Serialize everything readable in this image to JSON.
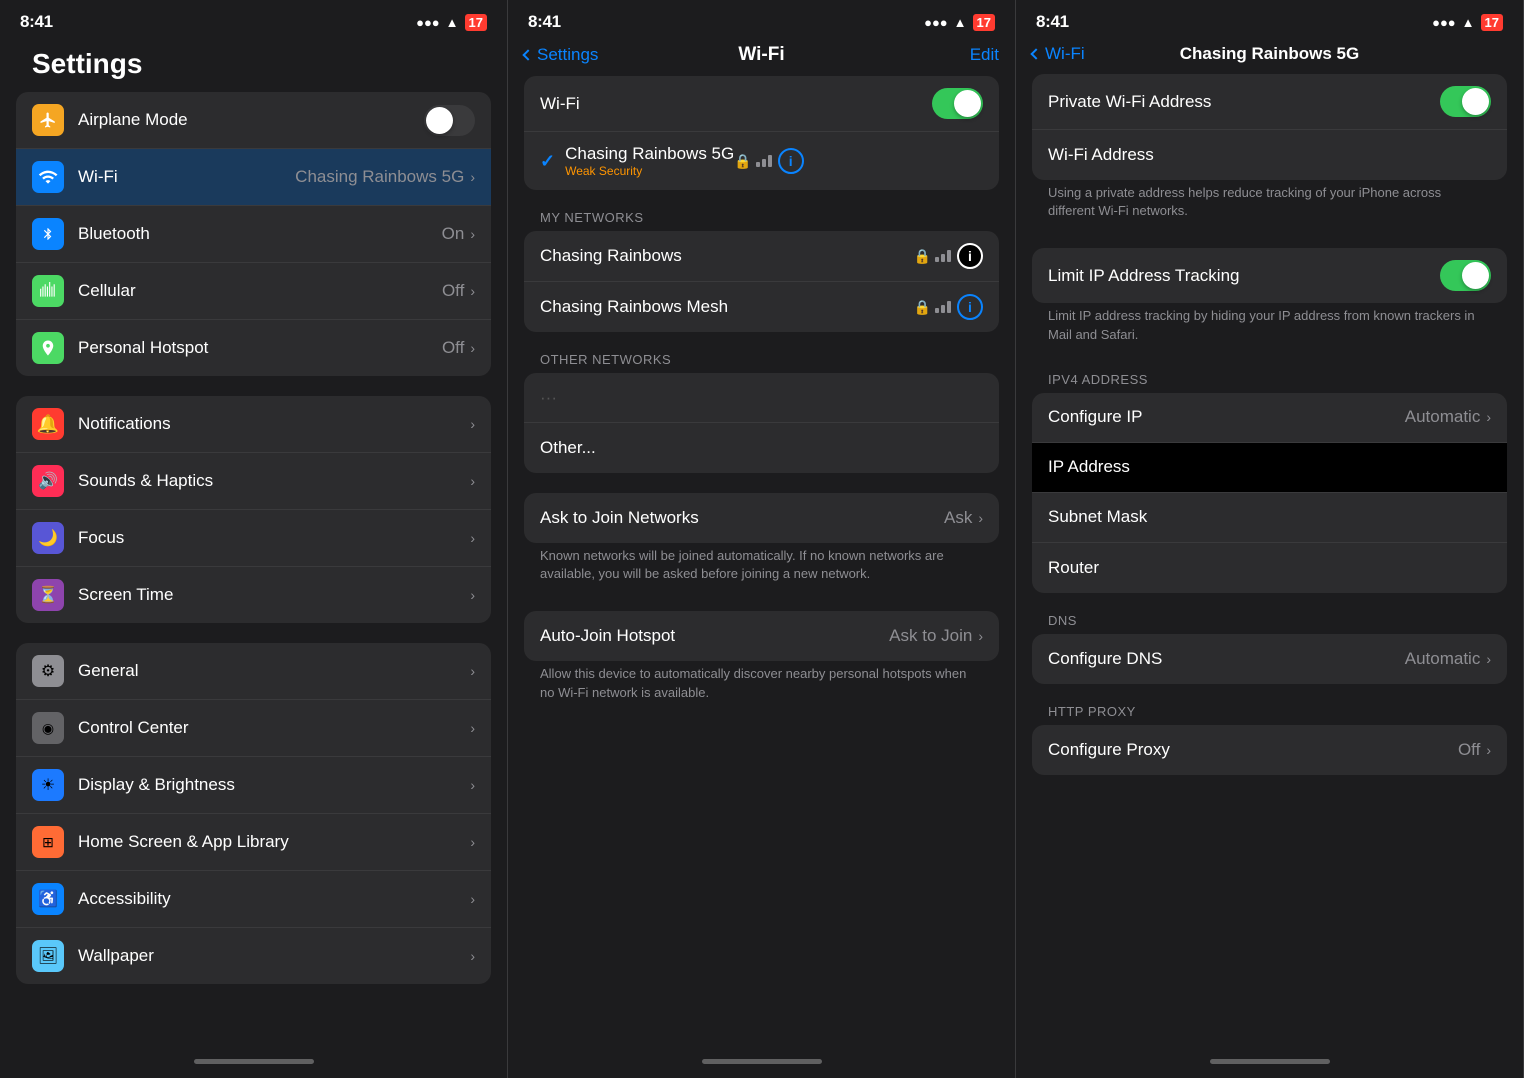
{
  "screens": [
    {
      "id": "settings-main",
      "statusBar": {
        "time": "8:41",
        "userIcon": "👤",
        "batteryValue": "17"
      },
      "title": "Settings",
      "groups": [
        {
          "id": "connectivity",
          "rows": [
            {
              "id": "airplane",
              "icon": "✈",
              "iconBg": "airplane",
              "label": "Airplane Mode",
              "toggle": "off",
              "hasChevron": false
            },
            {
              "id": "wifi",
              "icon": "wifi",
              "iconBg": "wifi",
              "label": "Wi-Fi",
              "value": "Chasing Rainbows 5G",
              "hasChevron": true,
              "highlighted": true
            },
            {
              "id": "bluetooth",
              "icon": "bluetooth",
              "iconBg": "bluetooth",
              "label": "Bluetooth",
              "value": "On",
              "hasChevron": true
            },
            {
              "id": "cellular",
              "icon": "cellular",
              "iconBg": "cellular",
              "label": "Cellular",
              "value": "Off",
              "hasChevron": true
            },
            {
              "id": "hotspot",
              "icon": "hotspot",
              "iconBg": "hotspot",
              "label": "Personal Hotspot",
              "value": "Off",
              "hasChevron": true
            }
          ]
        },
        {
          "id": "system1",
          "rows": [
            {
              "id": "notifications",
              "icon": "🔔",
              "iconBg": "notif",
              "label": "Notifications",
              "hasChevron": true
            },
            {
              "id": "sounds",
              "icon": "🔊",
              "iconBg": "sounds",
              "label": "Sounds & Haptics",
              "hasChevron": true
            },
            {
              "id": "focus",
              "icon": "🌙",
              "iconBg": "focus",
              "label": "Focus",
              "hasChevron": true
            },
            {
              "id": "screentime",
              "icon": "⏳",
              "iconBg": "screentime",
              "label": "Screen Time",
              "hasChevron": true
            }
          ]
        },
        {
          "id": "system2",
          "rows": [
            {
              "id": "general",
              "icon": "⚙",
              "iconBg": "general",
              "label": "General",
              "hasChevron": true
            },
            {
              "id": "controlcenter",
              "icon": "◉",
              "iconBg": "control",
              "label": "Control Center",
              "hasChevron": true
            },
            {
              "id": "display",
              "icon": "☀",
              "iconBg": "display",
              "label": "Display & Brightness",
              "hasChevron": true
            },
            {
              "id": "homescreen",
              "icon": "⊞",
              "iconBg": "homescreen",
              "label": "Home Screen & App Library",
              "hasChevron": true
            },
            {
              "id": "accessibility",
              "icon": "♿",
              "iconBg": "accessibility",
              "label": "Accessibility",
              "hasChevron": true
            },
            {
              "id": "wallpaper",
              "icon": "🖼",
              "iconBg": "wallpaper",
              "label": "Wallpaper",
              "hasChevron": true
            }
          ]
        }
      ]
    },
    {
      "id": "wifi-list",
      "statusBar": {
        "time": "8:41",
        "batteryValue": "17"
      },
      "backLabel": "Settings",
      "title": "Wi-Fi",
      "editLabel": "Edit",
      "groups": [
        {
          "id": "wifi-toggle",
          "rows": [
            {
              "id": "wifi-main",
              "label": "Wi-Fi",
              "toggle": "on"
            },
            {
              "id": "chasing-5g",
              "label": "Chasing Rainbows 5G",
              "sublabel": "Weak Security",
              "hasLock": true,
              "hasWifi": true,
              "hasInfo": true,
              "hasCheck": true
            }
          ]
        },
        {
          "id": "my-networks",
          "sectionLabel": "MY NETWORKS",
          "rows": [
            {
              "id": "chasing-rainbows",
              "label": "Chasing Rainbows",
              "hasLock": true,
              "hasWifi": true,
              "hasInfo": true,
              "infoHighlighted": true
            },
            {
              "id": "chasing-mesh",
              "label": "Chasing Rainbows Mesh",
              "hasLock": true,
              "hasWifi": true,
              "hasInfo": true
            }
          ]
        },
        {
          "id": "other-networks",
          "sectionLabel": "OTHER NETWORKS",
          "rows": [
            {
              "id": "other-dimmed",
              "label": "...",
              "dimmed": true
            },
            {
              "id": "other",
              "label": "Other..."
            }
          ]
        },
        {
          "id": "ask-join",
          "rows": [
            {
              "id": "ask-to-join",
              "label": "Ask to Join Networks",
              "value": "Ask",
              "hasChevron": true,
              "description": "Known networks will be joined automatically. If no known networks are available, you will be asked before joining a new network."
            }
          ]
        },
        {
          "id": "auto-join",
          "rows": [
            {
              "id": "auto-join-hotspot",
              "label": "Auto-Join Hotspot",
              "value": "Ask to Join",
              "hasChevron": true,
              "description": "Allow this device to automatically discover nearby personal hotspots when no Wi-Fi network is available."
            }
          ]
        }
      ]
    },
    {
      "id": "network-detail",
      "statusBar": {
        "time": "8:41",
        "batteryValue": "17"
      },
      "backLabel": "Wi-Fi",
      "title": "Chasing Rainbows 5G",
      "groups": [
        {
          "id": "privacy",
          "rows": [
            {
              "id": "private-wifi",
              "label": "Private Wi-Fi Address",
              "toggle": "on",
              "description": "Using a private address helps reduce tracking of your iPhone across different Wi-Fi networks."
            },
            {
              "id": "wifi-address",
              "label": "Wi-Fi Address"
            }
          ]
        },
        {
          "id": "limit-tracking",
          "rows": [
            {
              "id": "limit-ip",
              "label": "Limit IP Address Tracking",
              "toggle": "on",
              "description": "Limit IP address tracking by hiding your IP address from known trackers in Mail and Safari."
            }
          ]
        },
        {
          "id": "ipv4",
          "sectionLabel": "IPV4 ADDRESS",
          "rows": [
            {
              "id": "configure-ip",
              "label": "Configure IP",
              "value": "Automatic",
              "hasChevron": true
            },
            {
              "id": "ip-address",
              "label": "IP Address",
              "highlighted": true
            },
            {
              "id": "subnet-mask",
              "label": "Subnet Mask"
            },
            {
              "id": "router",
              "label": "Router"
            }
          ]
        },
        {
          "id": "dns",
          "sectionLabel": "DNS",
          "rows": [
            {
              "id": "configure-dns",
              "label": "Configure DNS",
              "value": "Automatic",
              "hasChevron": true
            }
          ]
        },
        {
          "id": "http-proxy",
          "sectionLabel": "HTTP PROXY",
          "rows": [
            {
              "id": "configure-proxy",
              "label": "Configure Proxy",
              "value": "Off",
              "hasChevron": true
            }
          ]
        }
      ]
    }
  ]
}
